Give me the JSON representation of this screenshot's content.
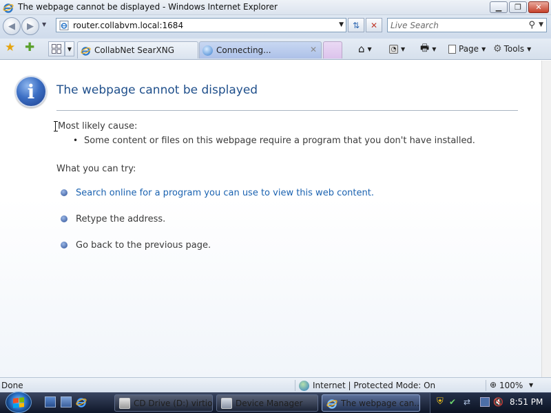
{
  "window": {
    "title": "The webpage cannot be displayed - Windows Internet Explorer",
    "controls": [
      "minimize",
      "maximize",
      "close"
    ]
  },
  "address_bar": {
    "url": "router.collabvm.local:1684",
    "icon": "ie-page-icon"
  },
  "search": {
    "placeholder": "Live Search",
    "value": ""
  },
  "tabs": [
    {
      "label": "CollabNet SearXNG",
      "active": false,
      "icon": "ie-icon"
    },
    {
      "label": "Connecting...",
      "active": true,
      "icon": "loading-globe-icon"
    }
  ],
  "command_bar": {
    "page_label": "Page",
    "tools_label": "Tools"
  },
  "content": {
    "heading": "The webpage cannot be displayed",
    "cause_label": "Most likely cause:",
    "causes": [
      "Some content or files on this webpage require a program that you don't have installed."
    ],
    "try_label": "What you can try:",
    "suggestions": [
      {
        "text": "Search online for a program you can use to view this web content.",
        "link": true
      },
      {
        "text": "Retype the address.",
        "link": false
      },
      {
        "text": "Go back to the previous page.",
        "link": false
      }
    ]
  },
  "status_bar": {
    "status": "Done",
    "zone": "Internet | Protected Mode: On",
    "zoom": "100%"
  },
  "taskbar": {
    "tasks": [
      {
        "label": "CD Drive (D:) virtio...",
        "active": false
      },
      {
        "label": "Device Manager",
        "active": false
      },
      {
        "label": "The webpage can...",
        "active": true
      }
    ],
    "clock": "8:51 PM"
  },
  "colors": {
    "heading": "#1f4f8b",
    "link": "#1a62b0",
    "taskbar": "#1b2438"
  }
}
